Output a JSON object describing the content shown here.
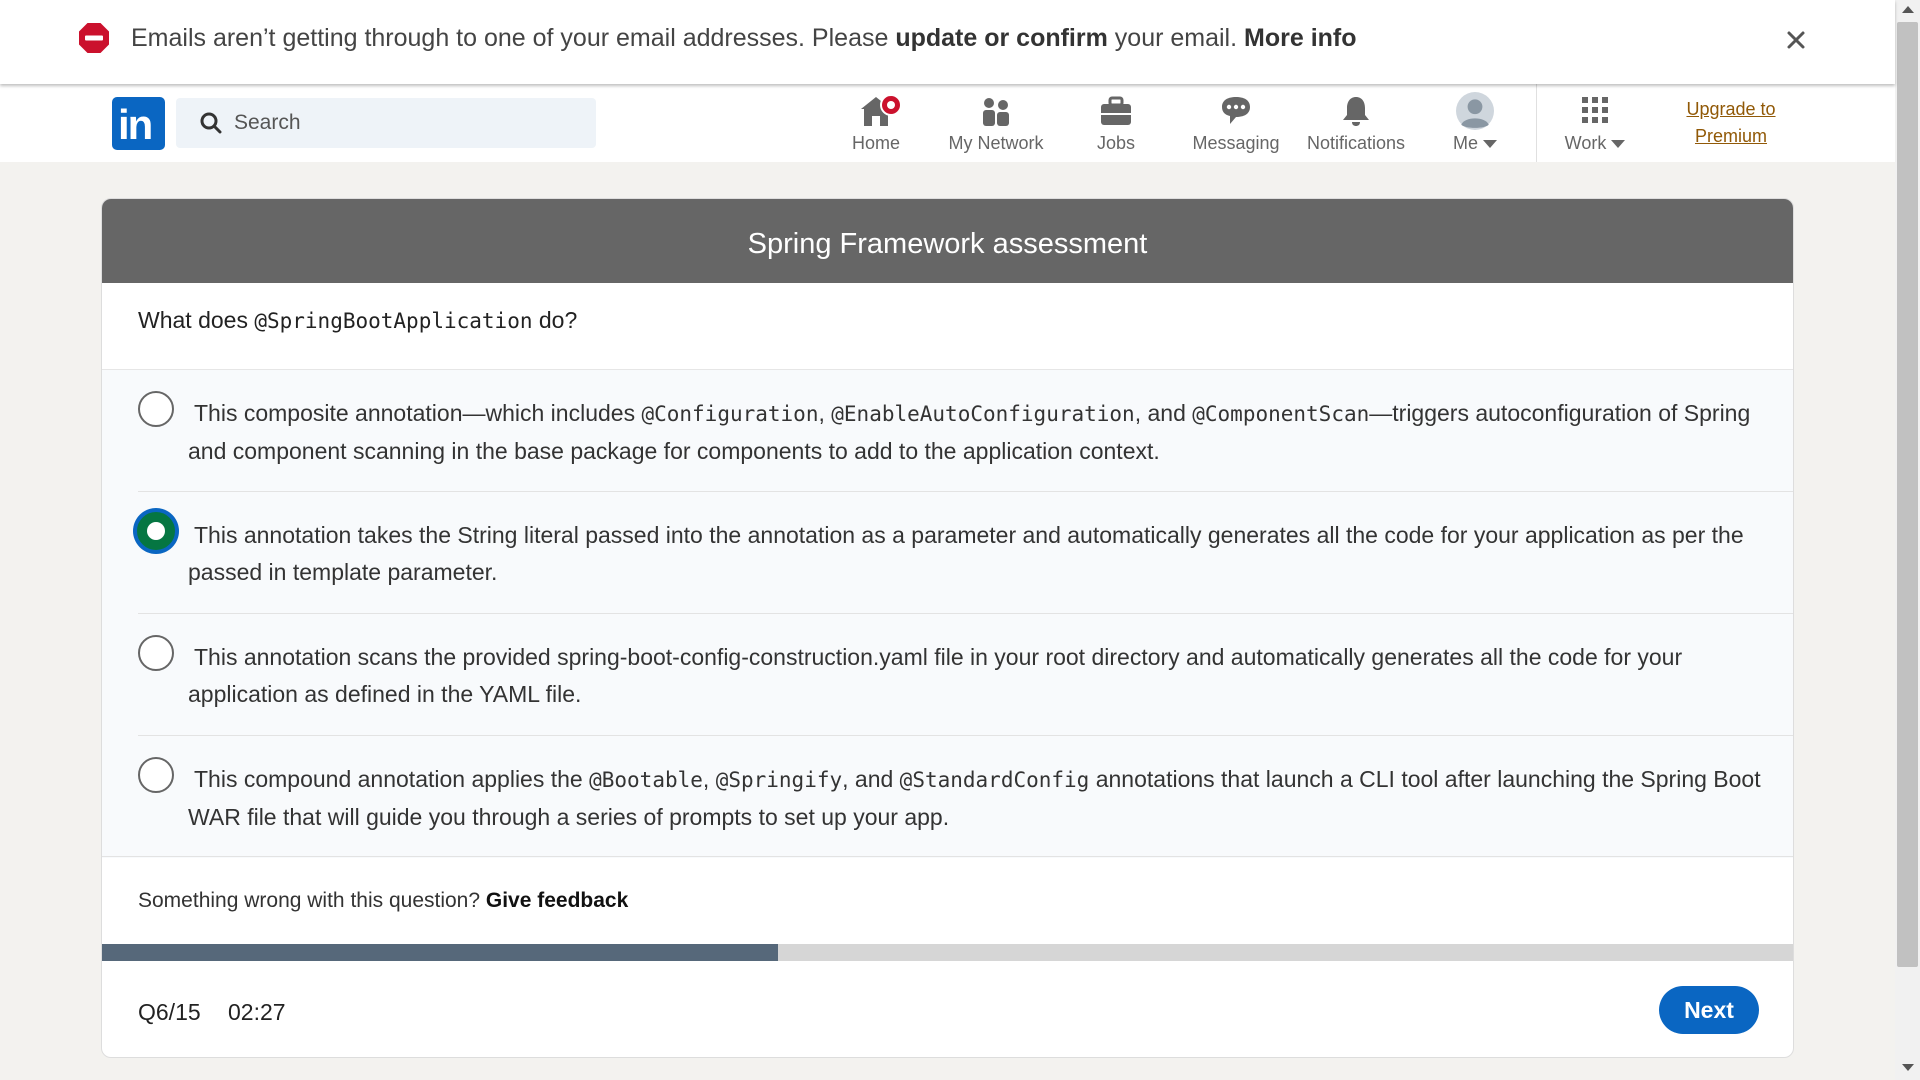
{
  "alert": {
    "text_before": "Emails aren’t getting through to one of your email addresses. Please ",
    "link_update": "update or confirm",
    "text_middle": " your email. ",
    "link_more": "More info"
  },
  "nav": {
    "logo": "in",
    "search_placeholder": "Search",
    "items": [
      {
        "label": "Home",
        "icon": "home-icon"
      },
      {
        "label": "My Network",
        "icon": "network-icon"
      },
      {
        "label": "Jobs",
        "icon": "briefcase-icon"
      },
      {
        "label": "Messaging",
        "icon": "chat-icon"
      },
      {
        "label": "Notifications",
        "icon": "bell-icon"
      },
      {
        "label": "Me",
        "icon": "avatar"
      },
      {
        "label": "Work",
        "icon": "grid-icon"
      }
    ],
    "premium_line1": "Upgrade to",
    "premium_line2": "Premium"
  },
  "assessment": {
    "title": "Spring Framework assessment",
    "question_prefix": "What does ",
    "question_code": "@SpringBootApplication",
    "question_suffix": " do?",
    "options": [
      {
        "selected": false,
        "parts": [
          {
            "t": "This composite annotation—which includes "
          },
          {
            "t": "@Configuration",
            "code": true
          },
          {
            "t": ", "
          },
          {
            "t": "@EnableAutoConfiguration",
            "code": true
          },
          {
            "t": ", and "
          },
          {
            "t": "@ComponentScan",
            "code": true
          },
          {
            "t": "—triggers autoconfiguration of Spring and component scanning in the base package for components to add to the application context."
          }
        ]
      },
      {
        "selected": true,
        "parts": [
          {
            "t": "This annotation takes the String literal passed into the annotation as a parameter and automatically generates all the code for your application as per the passed in template parameter."
          }
        ]
      },
      {
        "selected": false,
        "parts": [
          {
            "t": "This annotation scans the provided spring-boot-config-construction.yaml file in your root directory and automatically generates all the code for your application as defined in the YAML file."
          }
        ]
      },
      {
        "selected": false,
        "parts": [
          {
            "t": "This compound annotation applies the "
          },
          {
            "t": "@Bootable",
            "code": true
          },
          {
            "t": ", "
          },
          {
            "t": "@Springify",
            "code": true
          },
          {
            "t": ", and "
          },
          {
            "t": "@StandardConfig",
            "code": true
          },
          {
            "t": " annotations that launch a CLI tool after launching the Spring Boot WAR file that will guide you through a series of prompts to set up your app."
          }
        ]
      }
    ],
    "feedback_text": "Something wrong with this question? ",
    "feedback_link": "Give feedback",
    "progress_fraction": 0.4,
    "counter": "Q6/15",
    "timer": "02:27",
    "next_label": "Next"
  },
  "colors": {
    "brand": "#0a66c2",
    "header_bg": "#666666",
    "selected_radio": "#057642",
    "progress_fill": "#56687a",
    "badge": "#cb112d",
    "premium": "#915907"
  }
}
